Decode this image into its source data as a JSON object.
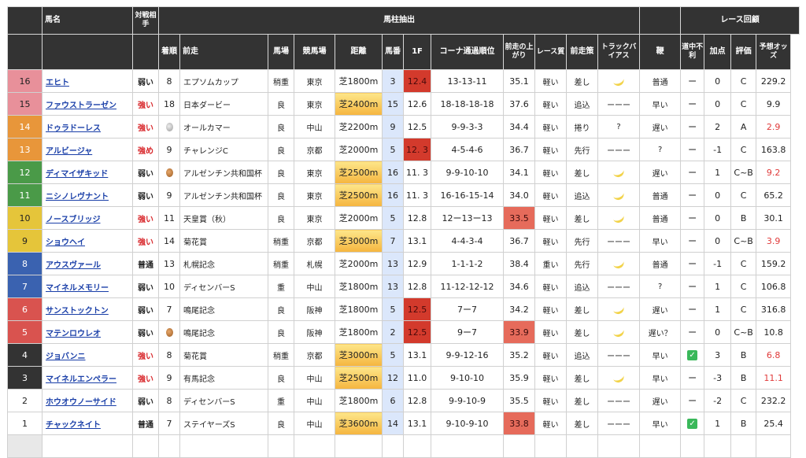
{
  "headers": {
    "horse": "馬名",
    "opponent": "対戦相手",
    "past": "馬柱抽出",
    "review": "レース回顧",
    "rating": "評価",
    "odds": "予想オッズ",
    "finish": "着順",
    "prev_race": "前走",
    "going": "馬場",
    "venue": "競馬場",
    "distance": "距離",
    "gate": "馬番",
    "first_furlong": "1F",
    "corner": "コーナ通過順位",
    "last3f": "前走の上がり",
    "level": "レース質",
    "style": "前走策",
    "bias": "トラックバイアス",
    "pace": "鞭",
    "trouble": "道中不利",
    "bonus": "加点"
  },
  "rows": [
    {
      "n": "16",
      "color": "#e8909a",
      "name": "エヒト",
      "opp": "弱い",
      "fin": "8",
      "medal": "",
      "prev": "エプソムカップ",
      "going": "稍重",
      "venue": "東京",
      "dist": "芝1800m",
      "dist_hl": false,
      "gate": "3",
      "f1": "12.4",
      "f1_hl": true,
      "corner": "13-13-11",
      "ag": "35.1",
      "ag_hl": false,
      "lvl": "軽い",
      "style": "差し",
      "bias": "banana",
      "bias_text": "",
      "pace": "普通",
      "trouble": "ー",
      "bonus": "0",
      "rating": "C",
      "odds": "229.2",
      "odds_red": false
    },
    {
      "n": "15",
      "color": "#e8909a",
      "name": "ファウストラーゼン",
      "opp": "強い",
      "fin": "18",
      "medal": "",
      "prev": "日本ダービー",
      "going": "良",
      "venue": "東京",
      "dist": "芝2400m",
      "dist_hl": true,
      "gate": "15",
      "f1": "12.6",
      "f1_hl": false,
      "corner": "18-18-18-18",
      "ag": "37.6",
      "ag_hl": false,
      "lvl": "軽い",
      "style": "追込",
      "bias": "text",
      "bias_text": "ーーー",
      "pace": "早い",
      "trouble": "ー",
      "bonus": "0",
      "rating": "C",
      "odds": "9.9",
      "odds_red": false
    },
    {
      "n": "14",
      "color": "#e8963a",
      "name": "ドゥラドーレス",
      "opp": "強い",
      "fin": "",
      "medal": "silver",
      "prev": "オールカマー",
      "going": "良",
      "venue": "中山",
      "dist": "芝2200m",
      "dist_hl": false,
      "gate": "9",
      "f1": "12.5",
      "f1_hl": false,
      "corner": "9-9-3-3",
      "ag": "34.4",
      "ag_hl": false,
      "lvl": "軽い",
      "style": "捲り",
      "bias": "text",
      "bias_text": "?",
      "pace": "遅い",
      "trouble": "ー",
      "bonus": "2",
      "rating": "A",
      "odds": "2.9",
      "odds_red": true
    },
    {
      "n": "13",
      "color": "#e8963a",
      "name": "アルビージャ",
      "opp": "強め",
      "fin": "9",
      "medal": "",
      "prev": "チャレンジC",
      "going": "良",
      "venue": "京都",
      "dist": "芝2000m",
      "dist_hl": false,
      "gate": "5",
      "f1": "12. 3",
      "f1_hl": true,
      "corner": "4-5-4-6",
      "ag": "36.7",
      "ag_hl": false,
      "lvl": "軽い",
      "style": "先行",
      "bias": "text",
      "bias_text": "ーーー",
      "pace": "?",
      "trouble": "ー",
      "bonus": "-1",
      "rating": "C",
      "odds": "163.8",
      "odds_red": false
    },
    {
      "n": "12",
      "color": "#4a9a48",
      "name": "ディマイザキッド",
      "opp": "弱い",
      "fin": "",
      "medal": "bronze",
      "prev": "アルゼンチン共和国杯",
      "going": "良",
      "venue": "東京",
      "dist": "芝2500m",
      "dist_hl": true,
      "gate": "16",
      "f1": "11. 3",
      "f1_hl": false,
      "corner": "9-9-10-10",
      "ag": "34.1",
      "ag_hl": false,
      "lvl": "軽い",
      "style": "差し",
      "bias": "banana",
      "bias_text": "",
      "pace": "遅い",
      "trouble": "ー",
      "bonus": "1",
      "rating": "C~B",
      "odds": "9.2",
      "odds_red": true
    },
    {
      "n": "11",
      "color": "#4a9a48",
      "name": "ニシノレヴナント",
      "opp": "弱い",
      "fin": "9",
      "medal": "",
      "prev": "アルゼンチン共和国杯",
      "going": "良",
      "venue": "東京",
      "dist": "芝2500m",
      "dist_hl": true,
      "gate": "16",
      "f1": "11. 3",
      "f1_hl": false,
      "corner": "16-16-15-14",
      "ag": "34.0",
      "ag_hl": false,
      "lvl": "軽い",
      "style": "追込",
      "bias": "banana",
      "bias_text": "",
      "pace": "普通",
      "trouble": "ー",
      "bonus": "0",
      "rating": "C",
      "odds": "65.2",
      "odds_red": false
    },
    {
      "n": "10",
      "color": "#e5c53a",
      "name": "ノースブリッジ",
      "opp": "強い",
      "fin": "11",
      "medal": "",
      "prev": "天皇賞（秋）",
      "going": "良",
      "venue": "東京",
      "dist": "芝2000m",
      "dist_hl": false,
      "gate": "5",
      "f1": "12.8",
      "f1_hl": false,
      "corner": "12ー13ー13",
      "ag": "33.5",
      "ag_hl": true,
      "lvl": "軽い",
      "style": "差し",
      "bias": "banana",
      "bias_text": "",
      "pace": "普通",
      "trouble": "ー",
      "bonus": "0",
      "rating": "B",
      "odds": "30.1",
      "odds_red": false
    },
    {
      "n": "9",
      "color": "#e5c53a",
      "name": "ショウヘイ",
      "opp": "強い",
      "fin": "14",
      "medal": "",
      "prev": "菊花賞",
      "going": "稍重",
      "venue": "京都",
      "dist": "芝3000m",
      "dist_hl": true,
      "gate": "7",
      "f1": "13.1",
      "f1_hl": false,
      "corner": "4-4-3-4",
      "ag": "36.7",
      "ag_hl": false,
      "lvl": "軽い",
      "style": "先行",
      "bias": "text",
      "bias_text": "ーーー",
      "pace": "早い",
      "trouble": "ー",
      "bonus": "0",
      "rating": "C~B",
      "odds": "3.9",
      "odds_red": true
    },
    {
      "n": "8",
      "color": "#3a62b0",
      "name": "アウスヴァール",
      "opp": "普通",
      "fin": "13",
      "medal": "",
      "prev": "札幌記念",
      "going": "稍重",
      "venue": "札幌",
      "dist": "芝2000m",
      "dist_hl": false,
      "gate": "13",
      "f1": "12.9",
      "f1_hl": false,
      "corner": "1-1-1-2",
      "ag": "38.4",
      "ag_hl": false,
      "lvl": "重い",
      "style": "先行",
      "bias": "banana",
      "bias_text": "",
      "pace": "普通",
      "trouble": "ー",
      "bonus": "-1",
      "rating": "C",
      "odds": "159.2",
      "odds_red": false
    },
    {
      "n": "7",
      "color": "#3a62b0",
      "name": "マイネルメモリー",
      "opp": "弱い",
      "fin": "10",
      "medal": "",
      "prev": "ディセンバーS",
      "going": "重",
      "venue": "中山",
      "dist": "芝1800m",
      "dist_hl": false,
      "gate": "13",
      "f1": "12.8",
      "f1_hl": false,
      "corner": "11-12-12-12",
      "ag": "34.6",
      "ag_hl": false,
      "lvl": "軽い",
      "style": "追込",
      "bias": "text",
      "bias_text": "ーーー",
      "pace": "?",
      "trouble": "ー",
      "bonus": "1",
      "rating": "C",
      "odds": "106.8",
      "odds_red": false
    },
    {
      "n": "6",
      "color": "#d9534f",
      "name": "サンストックトン",
      "opp": "弱い",
      "fin": "7",
      "medal": "",
      "prev": "鳴尾記念",
      "going": "良",
      "venue": "阪神",
      "dist": "芝1800m",
      "dist_hl": false,
      "gate": "5",
      "f1": "12.5",
      "f1_hl": true,
      "corner": "7ー7",
      "ag": "34.2",
      "ag_hl": false,
      "lvl": "軽い",
      "style": "差し",
      "bias": "banana",
      "bias_text": "",
      "pace": "遅い",
      "trouble": "ー",
      "bonus": "1",
      "rating": "C",
      "odds": "316.8",
      "odds_red": false
    },
    {
      "n": "5",
      "color": "#d9534f",
      "name": "マテンロウレオ",
      "opp": "弱い",
      "fin": "",
      "medal": "bronze",
      "prev": "鳴尾記念",
      "going": "良",
      "venue": "阪神",
      "dist": "芝1800m",
      "dist_hl": false,
      "gate": "2",
      "f1": "12.5",
      "f1_hl": true,
      "corner": "9ー7",
      "ag": "33.9",
      "ag_hl": true,
      "lvl": "軽い",
      "style": "差し",
      "bias": "banana",
      "bias_text": "",
      "pace": "遅い？",
      "trouble": "ー",
      "bonus": "0",
      "rating": "C~B",
      "odds": "10.8",
      "odds_red": false
    },
    {
      "n": "4",
      "color": "#333333",
      "name": "ジョバンニ",
      "opp": "強い",
      "fin": "8",
      "medal": "",
      "prev": "菊花賞",
      "going": "稍重",
      "venue": "京都",
      "dist": "芝3000m",
      "dist_hl": true,
      "gate": "5",
      "f1": "13.1",
      "f1_hl": false,
      "corner": "9-9-12-16",
      "ag": "35.2",
      "ag_hl": false,
      "lvl": "軽い",
      "style": "追込",
      "bias": "text",
      "bias_text": "ーーー",
      "pace": "早い",
      "trouble": "check",
      "bonus": "3",
      "rating": "B",
      "odds": "6.8",
      "odds_red": true
    },
    {
      "n": "3",
      "color": "#333333",
      "name": "マイネルエンペラー",
      "opp": "強い",
      "fin": "9",
      "medal": "",
      "prev": "有馬記念",
      "going": "良",
      "venue": "中山",
      "dist": "芝2500m",
      "dist_hl": true,
      "gate": "12",
      "f1": "11.0",
      "f1_hl": false,
      "corner": "9-10-10",
      "ag": "35.9",
      "ag_hl": false,
      "lvl": "軽い",
      "style": "差し",
      "bias": "banana",
      "bias_text": "",
      "pace": "早い",
      "trouble": "ー",
      "bonus": "-3",
      "rating": "B",
      "odds": "11.1",
      "odds_red": true
    },
    {
      "n": "2",
      "color": "#ffffff",
      "name": "ホウオウノーサイド",
      "opp": "弱い",
      "fin": "8",
      "medal": "",
      "prev": "ディセンバーS",
      "going": "重",
      "venue": "中山",
      "dist": "芝1800m",
      "dist_hl": false,
      "gate": "6",
      "f1": "12.8",
      "f1_hl": false,
      "corner": "9-9-10-9",
      "ag": "35.5",
      "ag_hl": false,
      "lvl": "軽い",
      "style": "差し",
      "bias": "text",
      "bias_text": "ーーー",
      "pace": "遅い",
      "trouble": "ー",
      "bonus": "-2",
      "rating": "C",
      "odds": "232.2",
      "odds_red": false
    },
    {
      "n": "1",
      "color": "#ffffff",
      "name": "チャックネイト",
      "opp": "普通",
      "fin": "7",
      "medal": "",
      "prev": "ステイヤーズS",
      "going": "良",
      "venue": "中山",
      "dist": "芝3600m",
      "dist_hl": true,
      "gate": "14",
      "f1": "13.1",
      "f1_hl": false,
      "corner": "9-10-9-10",
      "ag": "33.8",
      "ag_hl": true,
      "lvl": "軽い",
      "style": "差し",
      "bias": "text",
      "bias_text": "ーーー",
      "pace": "早い",
      "trouble": "check",
      "bonus": "1",
      "rating": "B",
      "odds": "25.4",
      "odds_red": false
    }
  ]
}
